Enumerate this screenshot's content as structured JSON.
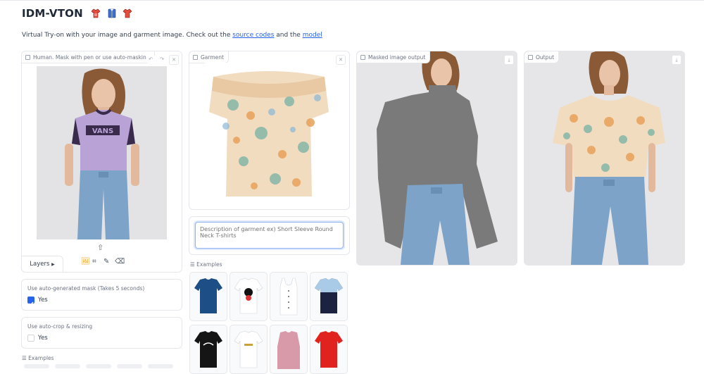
{
  "app": {
    "title": "IDM-VTON",
    "title_emojis": [
      "shirt-icon-red",
      "shirt-icon-blue",
      "shirt-icon-red2"
    ],
    "description_prefix": "Virtual Try-on with your image and garment image. Check out the ",
    "source_link": "source codes",
    "description_middle": " and the ",
    "model_link": "model"
  },
  "human_panel": {
    "label": "Human. Mask with pen or use auto-masking",
    "layers_label": "Layers"
  },
  "garment_panel": {
    "label": "Garment",
    "description_placeholder": "Description of garment ex) Short Sleeve Round Neck T-shirts"
  },
  "masked_panel": {
    "label": "Masked image output"
  },
  "output_panel": {
    "label": "Output"
  },
  "auto_mask": {
    "label": "Use auto-generated mask (Takes 5 seconds)",
    "option": "Yes",
    "checked": true
  },
  "auto_crop": {
    "label": "Use auto-crop & resizing",
    "option": "Yes",
    "checked": false
  },
  "garment_examples_label": "Examples",
  "human_examples_label": "Examples",
  "colors": {
    "accent": "#2563eb",
    "border": "#e5e7eb",
    "mask_gray": "#7a7a7a",
    "lavender": "#b9a3d6",
    "navy": "#3a2a4c",
    "denim": "#7ea3c8"
  }
}
